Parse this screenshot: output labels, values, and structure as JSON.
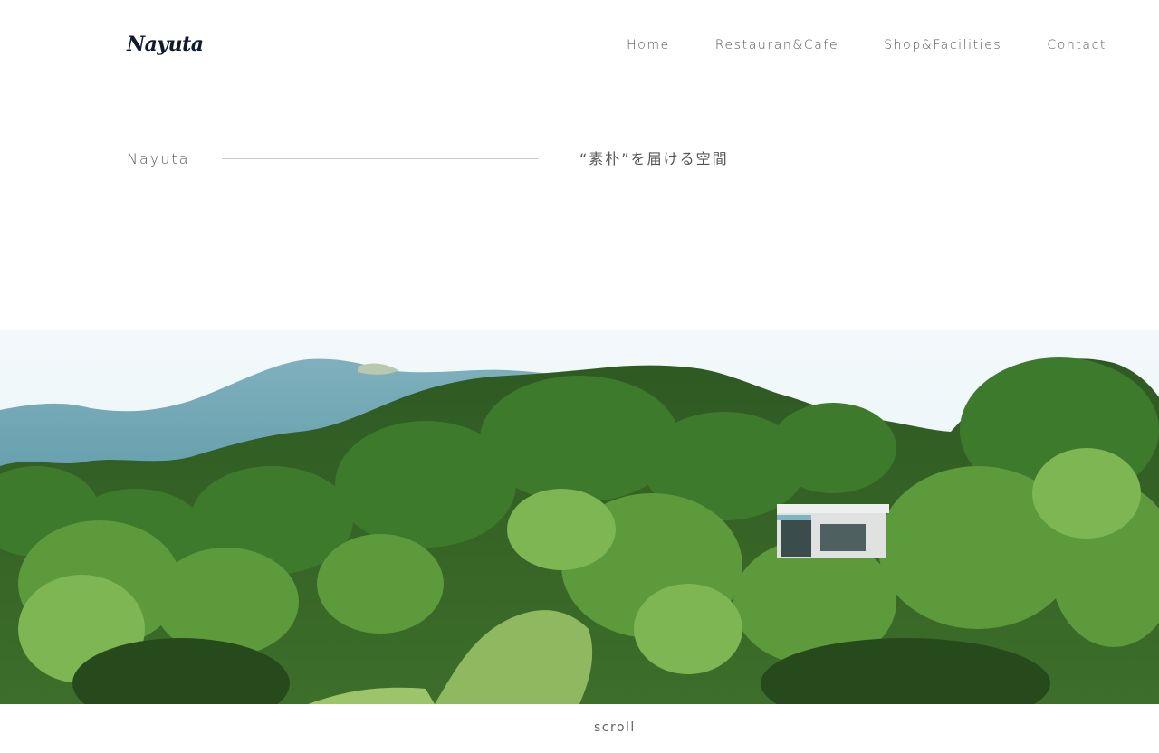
{
  "header": {
    "logo_text": "Nayuta",
    "nav": [
      {
        "label": "Home"
      },
      {
        "label": "Restauran&Cafe"
      },
      {
        "label": "Shop&Facilities"
      },
      {
        "label": "Contact"
      }
    ]
  },
  "intro": {
    "label": "Nayuta",
    "tagline": "“素朴”を届ける空間"
  },
  "hero": {
    "image_description": "forest hillside with a white building among trees",
    "colors": {
      "sky": "#eef6f8",
      "mountain": "#6a9fb0",
      "forest_dark": "#2f5a24",
      "forest_mid": "#4f8a36",
      "forest_light": "#7fb45a",
      "building": "#d9dcdc"
    }
  },
  "scroll": {
    "label": "scroll"
  }
}
